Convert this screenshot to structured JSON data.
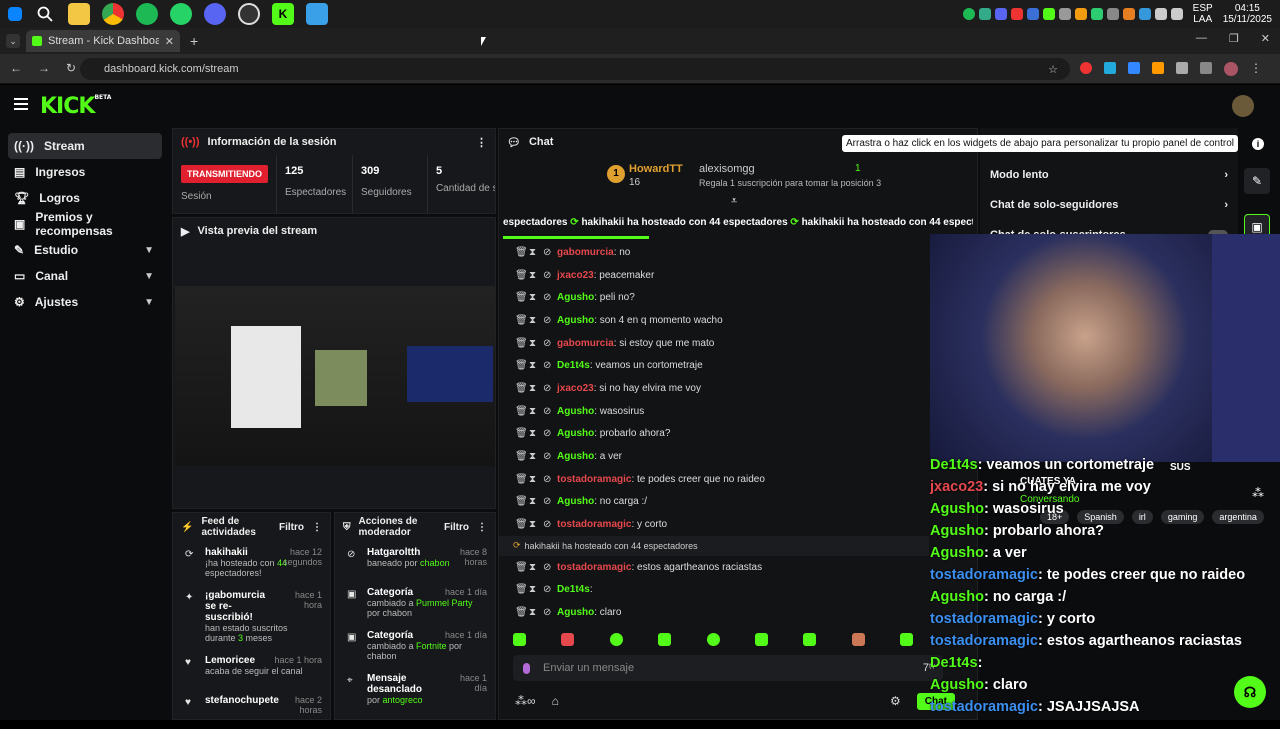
{
  "browser": {
    "tab_title": "Stream - Kick Dashboard",
    "url": "dashboard.kick.com/stream",
    "clock_time": "04:15",
    "clock_date": "15/11/2025",
    "lang": "ESP",
    "lang_sub": "LAA"
  },
  "app": {
    "logo": "KICK",
    "logo_beta": "BETA"
  },
  "sidebar": {
    "items": [
      {
        "label": "Stream",
        "icon": "broadcast-icon"
      },
      {
        "label": "Ingresos",
        "icon": "wallet-icon"
      },
      {
        "label": "Logros",
        "icon": "trophy-icon"
      },
      {
        "label": "Premios y recompensas",
        "icon": "gift-icon"
      },
      {
        "label": "Estudio",
        "icon": "studio-icon"
      },
      {
        "label": "Canal",
        "icon": "channel-icon"
      },
      {
        "label": "Ajustes",
        "icon": "gear-icon"
      }
    ]
  },
  "session": {
    "title": "Información de la sesión",
    "live_badge": "TRANSMITIENDO",
    "session_label": "Sesión",
    "stats": [
      {
        "value": "125",
        "label": "Espectadores"
      },
      {
        "value": "309",
        "label": "Seguidores"
      },
      {
        "value": "5",
        "label": "Cantidad de suscripciones"
      }
    ]
  },
  "preview": {
    "title": "Vista previa del stream"
  },
  "feed": {
    "title": "Feed de actividades",
    "filter": "Filtro",
    "items": [
      {
        "name": "hakihakii",
        "time": "hace 12 segundos",
        "desc_a": "¡ha hosteado con ",
        "desc_b": "44",
        "desc_c": " espectadores!"
      },
      {
        "name": "¡gabomurcia se re-suscribió!",
        "time": "hace 1 hora",
        "desc_a": "han estado suscritos durante ",
        "desc_b": "3",
        "desc_c": " meses"
      },
      {
        "name": "Lemoricee",
        "time": "hace 1 hora",
        "desc_a": "acaba de seguir el canal",
        "desc_b": "",
        "desc_c": ""
      },
      {
        "name": "stefanochupete",
        "time": "hace 2 horas",
        "desc_a": "",
        "desc_b": "",
        "desc_c": ""
      }
    ]
  },
  "modactions": {
    "title": "Acciones de moderador",
    "filter": "Filtro",
    "items": [
      {
        "name": "Hatgaroltth",
        "time": "hace 8 horas",
        "desc_a": "baneado por ",
        "desc_b": "chabon",
        "desc_c": ""
      },
      {
        "name": "Categoría",
        "time": "hace 1 día",
        "desc_a": "cambiado a ",
        "desc_b": "Pummel Party",
        "desc_c": " por chabon"
      },
      {
        "name": "Categoría",
        "time": "hace 1 día",
        "desc_a": "cambiado a ",
        "desc_b": "Fortnite",
        "desc_c": " por chabon"
      },
      {
        "name": "Mensaje desanclado",
        "time": "hace 1 día",
        "desc_a": "por ",
        "desc_b": "antogreco",
        "desc_c": ""
      }
    ]
  },
  "chat": {
    "title": "Chat",
    "top_gifter": {
      "name": "HowardTT",
      "count": "16"
    },
    "second_gifter": {
      "name": "alexisomgg",
      "count": "1",
      "note": "Regala 1 suscripción para tomar la posición 3"
    },
    "host_banner": "hakihakii ha hosteado con 44 espectadores",
    "host_banner_short": "espectadores",
    "messages": [
      {
        "user": "gabomurcia",
        "color": "#e5484d",
        "text": ": no"
      },
      {
        "user": "jxaco23",
        "color": "#e5484d",
        "text": ": peacemaker"
      },
      {
        "user": "Agusho",
        "color": "#53fc18",
        "text": ": peli no?"
      },
      {
        "user": "Agusho",
        "color": "#53fc18",
        "text": ": son 4 en q momento wacho"
      },
      {
        "user": "gabomurcia",
        "color": "#e5484d",
        "text": ": si estoy que me mato"
      },
      {
        "user": "De1t4s",
        "color": "#53fc18",
        "text": ": veamos un cortometraje"
      },
      {
        "user": "jxaco23",
        "color": "#e5484d",
        "text": ": si no hay elvira     me voy"
      },
      {
        "user": "Agusho",
        "color": "#53fc18",
        "text": ": wasosirus"
      },
      {
        "user": "Agusho",
        "color": "#53fc18",
        "text": ": probarlo ahora?"
      },
      {
        "user": "Agusho",
        "color": "#53fc18",
        "text": ": a ver"
      },
      {
        "user": "tostadoramagic",
        "color": "#e5484d",
        "text": ": te podes creer que no raideo"
      },
      {
        "user": "Agusho",
        "color": "#53fc18",
        "text": ": no carga :/"
      },
      {
        "user": "tostadoramagic",
        "color": "#e5484d",
        "text": ": y corto"
      }
    ],
    "host_event": "hakihakii ha hosteado con 44 espectadores",
    "messages2": [
      {
        "user": "tostadoramagic",
        "color": "#e5484d",
        "text": ": estos agartheanos raciastas"
      },
      {
        "user": "De1t4s",
        "color": "#53fc18",
        "text": ":"
      },
      {
        "user": "Agusho",
        "color": "#53fc18",
        "text": ": claro"
      }
    ],
    "input_placeholder": "Enviar un mensaje",
    "send_label": "Chat"
  },
  "tooltip": "Arrastra o haz click en los widgets de abajo para personalizar tu propio panel de control",
  "right_panel": {
    "items": [
      "Modo lento",
      "Chat de solo-seguidores",
      "Chat de solo-suscriptores"
    ]
  },
  "overlay": {
    "tags": [
      "18+",
      "Spanish",
      "irl",
      "gaming",
      "argentina"
    ],
    "status": "Conversando",
    "cuates": "CUATES YA",
    "sus": "SUS",
    "lines": [
      {
        "user": "De1t4s",
        "text": ": veamos un cortometraje"
      },
      {
        "user": "jxaco23",
        "text": ": si no hay elvira    me voy"
      },
      {
        "user": "Agusho",
        "text": ": wasosirus"
      },
      {
        "user": "Agusho",
        "text": ": probarlo ahora?"
      },
      {
        "user": "Agusho",
        "text": ": a ver"
      },
      {
        "user": "tostadoramagic",
        "text": ": te podes creer que no raideo"
      },
      {
        "user": "Agusho",
        "text": ": no carga :/"
      },
      {
        "user": "tostadoramagic",
        "text": ": y corto"
      },
      {
        "user": "tostadoramagic",
        "text": ": estos agartheanos raciastas"
      },
      {
        "user": "De1t4s",
        "text": ":"
      },
      {
        "user": "Agusho",
        "text": ": claro"
      },
      {
        "user": "tostadoramagic",
        "text": ": JSAJJSAJSA"
      }
    ]
  }
}
